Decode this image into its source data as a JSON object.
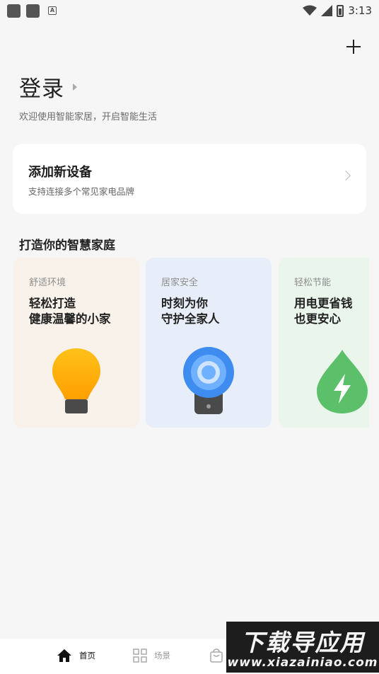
{
  "status_bar": {
    "time": "3:13",
    "left_icons": [
      "notification-icon",
      "notification-icon",
      "font-icon"
    ],
    "right_icons": [
      "wifi-icon",
      "signal-icon",
      "battery-icon"
    ]
  },
  "header": {
    "add_icon": "plus-icon",
    "login_title": "登录",
    "subtitle": "欢迎使用智能家居，开启智能生活"
  },
  "add_device": {
    "title": "添加新设备",
    "subtitle": "支持连接多个常见家电品牌"
  },
  "section": {
    "title": "打造你的智慧家庭"
  },
  "scenes": [
    {
      "category": "舒适环境",
      "line1": "轻松打造",
      "line2": "健康温馨的小家",
      "icon": "lightbulb-icon",
      "bg_color": "#f8f2ea"
    },
    {
      "category": "居家安全",
      "line1": "时刻为你",
      "line2": "守护全家人",
      "icon": "security-camera-icon",
      "bg_color": "#e8eef9"
    },
    {
      "category": "轻松节能",
      "line1": "用电更省钱",
      "line2": "也更安心",
      "icon": "energy-drop-icon",
      "bg_color": "#eaf5ec"
    }
  ],
  "bottom_nav": {
    "items": [
      {
        "label": "首页",
        "icon": "home-icon",
        "active": true
      },
      {
        "label": "场景",
        "icon": "grid-icon",
        "active": false
      },
      {
        "label": "",
        "icon": "shopping-bag-icon",
        "active": false
      }
    ]
  },
  "watermark": {
    "line1": "下载导应用",
    "line2": "www.xiazainiao.com"
  },
  "colors": {
    "background": "#f6f6f7",
    "card": "#ffffff",
    "bulb": "#ffb300",
    "camera": "#3f8cf0",
    "energy": "#5cc06a"
  }
}
